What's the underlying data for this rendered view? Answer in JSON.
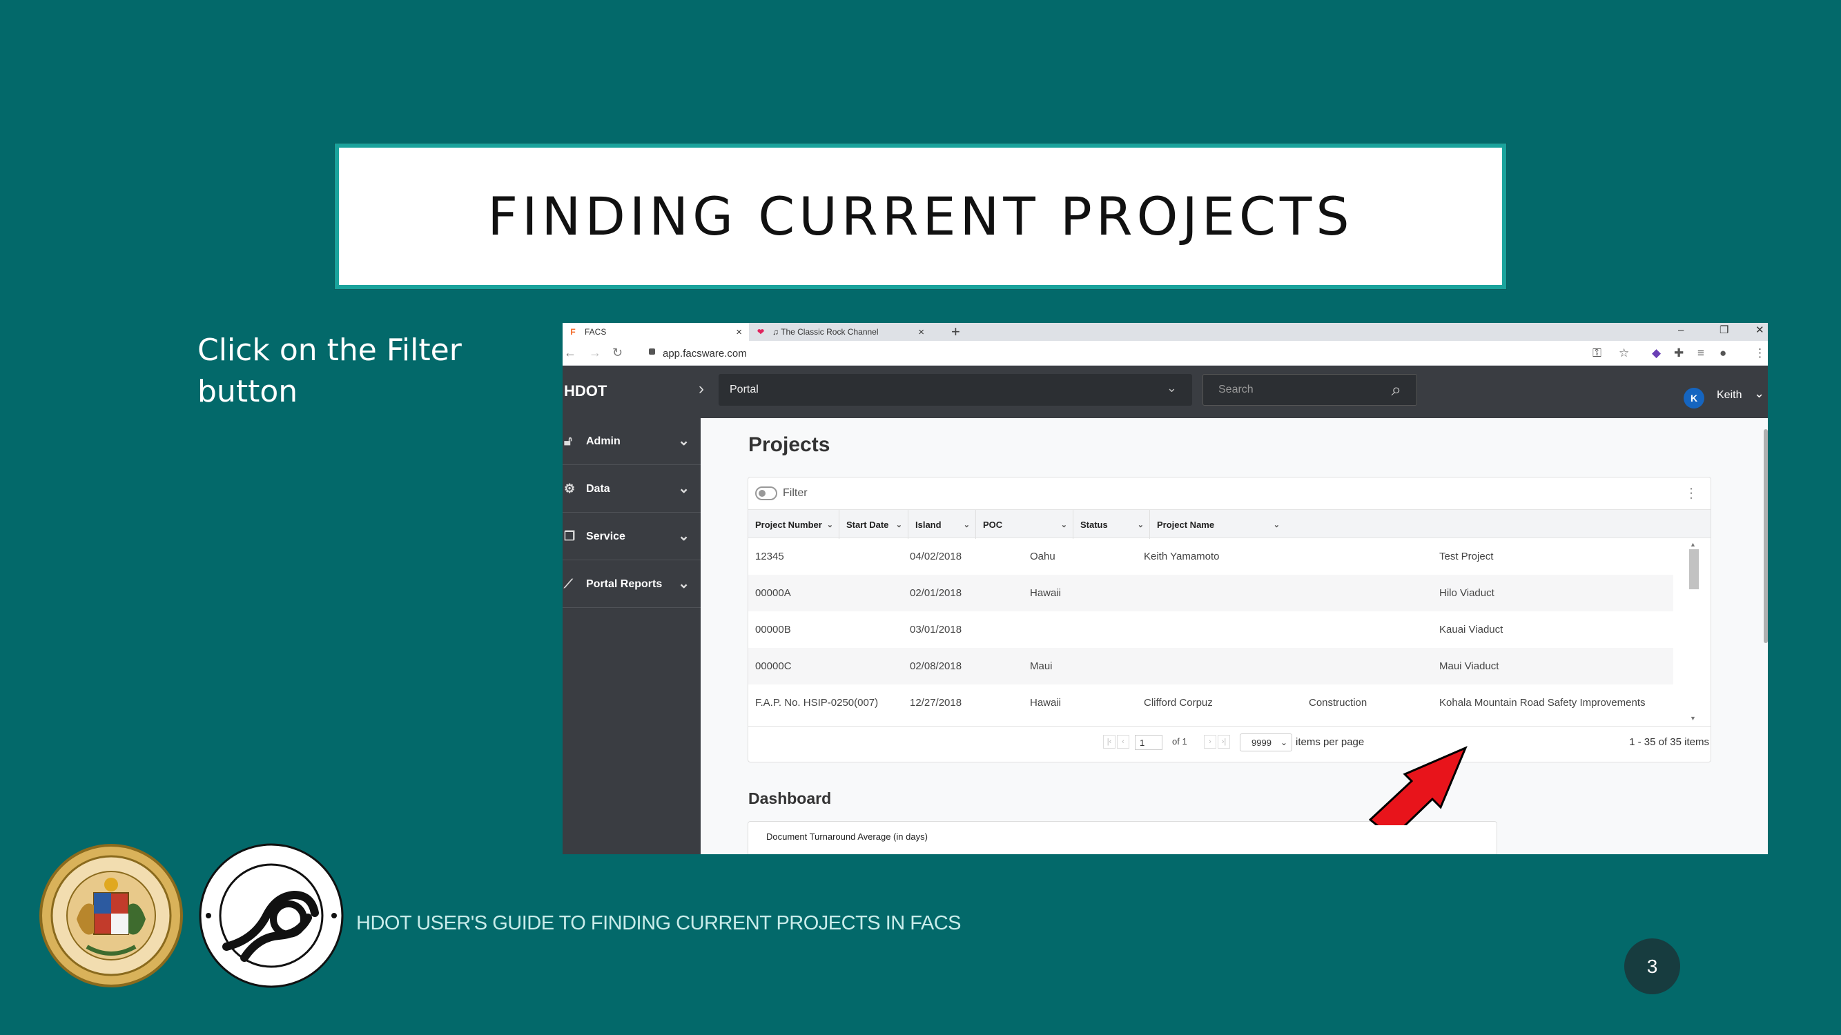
{
  "slide": {
    "title": "FINDING CURRENT PROJECTS",
    "instruction": "Click on the Filter button",
    "footer_text": "HDOT USER'S GUIDE TO FINDING CURRENT PROJECTS IN FACS",
    "page_number": "3"
  },
  "browser": {
    "tabs": [
      {
        "label": "FACS",
        "icon": "facs-logo-icon",
        "close": "×"
      },
      {
        "label": "♫ The Classic Rock Channel",
        "icon": "heart-icon",
        "close": "×"
      }
    ],
    "new_tab": "+",
    "url": "app.facsware.com",
    "window_controls": [
      "–",
      "❐",
      "✕"
    ]
  },
  "app": {
    "brand": "HDOT",
    "portal_select": "Portal",
    "search_placeholder": "Search",
    "user": {
      "initial": "K",
      "name": "Keith"
    }
  },
  "sidebar": {
    "items": [
      {
        "label": "Admin",
        "icon": "lock-icon"
      },
      {
        "label": "Data",
        "icon": "gears-icon"
      },
      {
        "label": "Service",
        "icon": "documents-icon"
      },
      {
        "label": "Portal Reports",
        "icon": "chart-line-icon"
      }
    ]
  },
  "main": {
    "title": "Projects",
    "filter_label": "Filter",
    "columns": [
      "Project Number",
      "Start Date",
      "Island",
      "POC",
      "Status",
      "Project Name"
    ],
    "rows": [
      [
        "12345",
        "04/02/2018",
        "Oahu",
        "Keith Yamamoto",
        "",
        "Test Project"
      ],
      [
        "00000A",
        "02/01/2018",
        "Hawaii",
        "",
        "",
        "Hilo Viaduct"
      ],
      [
        "00000B",
        "03/01/2018",
        "",
        "",
        "",
        "Kauai Viaduct"
      ],
      [
        "00000C",
        "02/08/2018",
        "Maui",
        "",
        "",
        "Maui Viaduct"
      ],
      [
        "F.A.P. No. HSIP-0250(007)",
        "12/27/2018",
        "Hawaii",
        "Clifford Corpuz",
        "Construction",
        "Kohala Mountain Road Safety Improvements"
      ]
    ],
    "pager": {
      "page": "1",
      "of": "of 1",
      "page_size": "9999",
      "items_per_page": "items per page",
      "count": "1 - 35 of 35 items"
    },
    "dashboard_title": "Dashboard",
    "dashboard_card": "Document Turnaround Average (in days)"
  },
  "colors": {
    "slide_bg": "#03696a",
    "title_border": "#1aa39c",
    "app_dark": "#3a3d42",
    "arrow": "#e8141b",
    "page_num_bg": "#173c3f"
  }
}
